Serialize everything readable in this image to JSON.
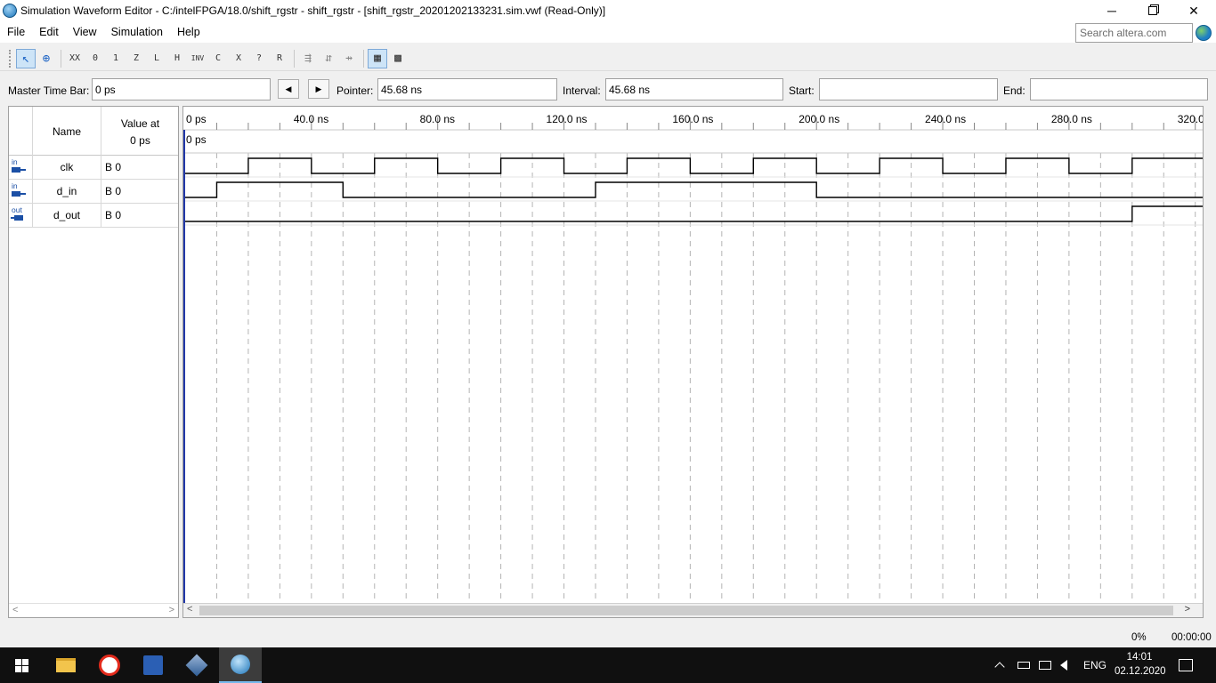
{
  "window": {
    "title": "Simulation Waveform Editor - C:/intelFPGA/18.0/shift_rgstr - shift_rgstr - [shift_rgstr_20201202133231.sim.vwf (Read-Only)]",
    "minimize": "─",
    "close": "✕"
  },
  "menu": {
    "items": [
      "File",
      "Edit",
      "View",
      "Simulation",
      "Help"
    ],
    "search_placeholder": "Search altera.com"
  },
  "toolbar": {
    "icons": [
      "pointer-icon",
      "zoom-icon",
      "unknown-icon",
      "force-low-icon",
      "force-high-icon",
      "high-impedance-icon",
      "weak-low-icon",
      "weak-high-icon",
      "invert-icon",
      "count-value-icon",
      "clock-icon",
      "arbitrary-value-icon",
      "random-value-icon",
      "snap-to-grid-icon",
      "reorder-icon",
      "grid-icon"
    ],
    "glyphs": [
      "↖",
      "⊕",
      "XX",
      "0",
      "1",
      "Z",
      "L",
      "H",
      "INV",
      "C",
      "X",
      "?",
      "R",
      "⇶",
      "⇵",
      "⇸",
      "▦",
      "▩"
    ]
  },
  "timebar": {
    "master_label": "Master Time Bar:",
    "master_value": "0 ps",
    "prev_glyph": "◀",
    "next_glyph": "▶",
    "pointer_label": "Pointer:",
    "pointer_value": "45.68 ns",
    "interval_label": "Interval:",
    "interval_value": "45.68 ns",
    "start_label": "Start:",
    "start_value": "",
    "end_label": "End:",
    "end_value": ""
  },
  "node_list": {
    "header_name": "Name",
    "header_value_line1": "Value at",
    "header_value_line2": "0 ps",
    "nodes": [
      {
        "name": "clk",
        "dir": "in",
        "value": "B 0"
      },
      {
        "name": "d_in",
        "dir": "in",
        "value": "B 0"
      },
      {
        "name": "d_out",
        "dir": "out",
        "value": "B 0"
      }
    ],
    "scroll_left": "<",
    "scroll_right": ">"
  },
  "waveform": {
    "time_unit": "ns",
    "time_max": 320,
    "visible_end_ns": 320,
    "grid_step_ns": 10,
    "tick_labels": [
      "0 ps",
      "40.0 ns",
      "80.0 ns",
      "120.0 ns",
      "160.0 ns",
      "200.0 ns",
      "240.0 ns",
      "280.0 ns",
      "320.0 ns"
    ],
    "tick_values_ns": [
      0,
      40,
      80,
      120,
      160,
      200,
      240,
      280,
      320
    ],
    "master_marker_label": "0 ps",
    "signals": [
      {
        "name": "clk",
        "transitions": [
          [
            0,
            0
          ],
          [
            20,
            1
          ],
          [
            40,
            0
          ],
          [
            60,
            1
          ],
          [
            80,
            0
          ],
          [
            100,
            1
          ],
          [
            120,
            0
          ],
          [
            140,
            1
          ],
          [
            160,
            0
          ],
          [
            180,
            1
          ],
          [
            200,
            0
          ],
          [
            220,
            1
          ],
          [
            240,
            0
          ],
          [
            260,
            1
          ],
          [
            280,
            0
          ],
          [
            300,
            1
          ]
        ]
      },
      {
        "name": "d_in",
        "transitions": [
          [
            0,
            0
          ],
          [
            10,
            1
          ],
          [
            50,
            0
          ],
          [
            130,
            1
          ],
          [
            200,
            0
          ]
        ]
      },
      {
        "name": "d_out",
        "transitions": [
          [
            0,
            0
          ],
          [
            300,
            1
          ]
        ]
      }
    ],
    "scroll_left": "<",
    "scroll_right": ">"
  },
  "status": {
    "progress": "0%",
    "elapsed": "00:00:00"
  },
  "taskbar": {
    "lang": "ENG",
    "time": "14:01",
    "date": "02.12.2020"
  }
}
